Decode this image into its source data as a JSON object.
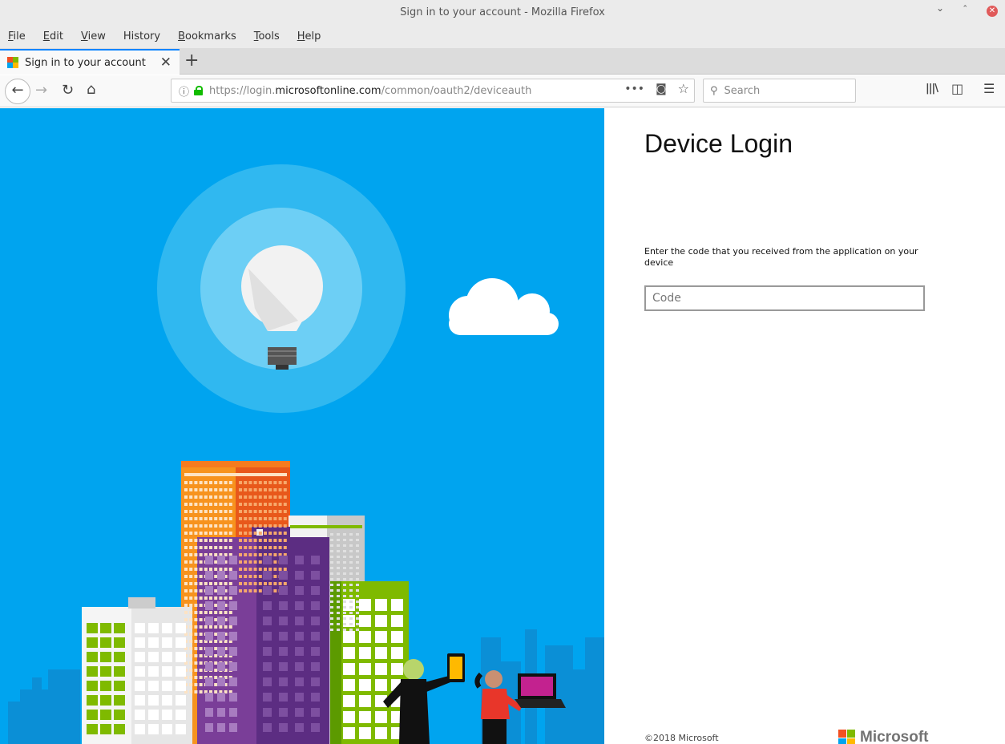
{
  "window": {
    "title": "Sign in to your account - Mozilla Firefox",
    "controls": {
      "minimize": "⌄",
      "maximize": "⌃",
      "close": "✕"
    }
  },
  "menubar": {
    "items": [
      {
        "label": "File",
        "mnemonic": "F",
        "rest": "ile"
      },
      {
        "label": "Edit",
        "mnemonic": "E",
        "rest": "dit"
      },
      {
        "label": "View",
        "mnemonic": "V",
        "rest": "iew"
      },
      {
        "label": "History",
        "mnemonic": "",
        "rest": "History"
      },
      {
        "label": "Bookmarks",
        "mnemonic": "B",
        "rest": "ookmarks"
      },
      {
        "label": "Tools",
        "mnemonic": "T",
        "rest": "ools"
      },
      {
        "label": "Help",
        "mnemonic": "H",
        "rest": "elp"
      }
    ]
  },
  "tabs": {
    "active": {
      "title": "Sign in to your account",
      "close": "✕"
    },
    "new_tab": "+"
  },
  "navbar": {
    "back": "←",
    "forward": "→",
    "reload": "↻",
    "home": "⌂",
    "url_prefix": "https://login.",
    "url_host": "microsoftonline.com",
    "url_path": "/common/oauth2/deviceauth",
    "info": "ⓘ",
    "more": "•••",
    "pocket": "◙",
    "bookmark": "☆",
    "search_placeholder": "Search",
    "search_icon": "⚲",
    "library": "|||\\",
    "sidebar": "◫",
    "menu": "☰"
  },
  "panel": {
    "heading": "Device Login",
    "instruction": "Enter the code that you received from the application on your device",
    "code_placeholder": "Code",
    "code_value": "",
    "copyright": "©2018 Microsoft",
    "logo_text": "Microsoft"
  },
  "colors": {
    "hero_bg": "#00a4ef",
    "ms_red": "#f25022",
    "ms_green": "#7fba00",
    "ms_blue": "#00a4ef",
    "ms_yellow": "#ffb900",
    "accent_tab": "#0a84ff",
    "lock_green": "#12bc00"
  }
}
